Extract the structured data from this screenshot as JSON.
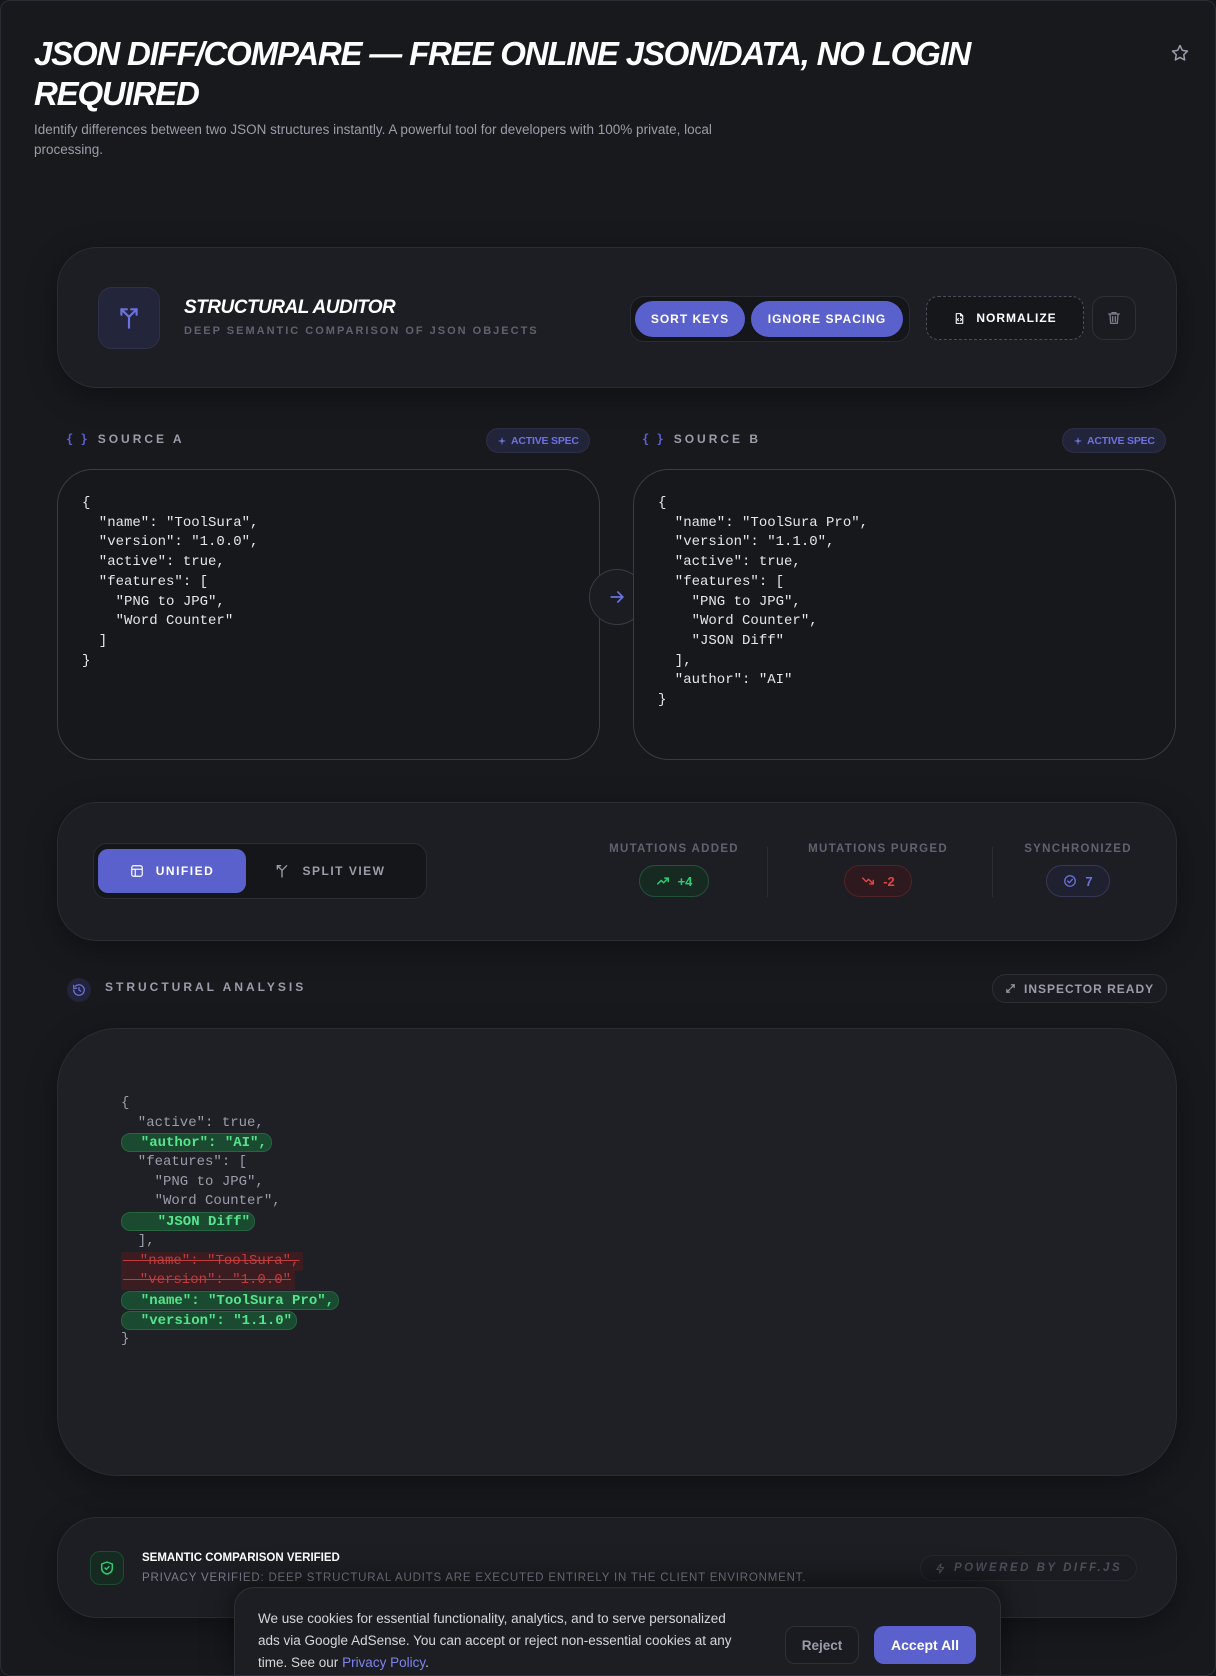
{
  "header": {
    "title": "JSON DIFF/COMPARE — FREE ONLINE JSON/DATA, NO LOGIN REQUIRED",
    "subtitle": "Identify differences between two JSON structures instantly. A powerful tool for developers with 100% private, local processing."
  },
  "auditor": {
    "title": "STRUCTURAL AUDITOR",
    "subtitle": "DEEP SEMANTIC COMPARISON OF JSON OBJECTS",
    "sort_keys": "SORT KEYS",
    "ignore_spacing": "IGNORE SPACING",
    "normalize": "NORMALIZE"
  },
  "source_a": {
    "label": "SOURCE A",
    "brace": "{ }",
    "badge": "ACTIVE SPEC",
    "content": "{\n  \"name\": \"ToolSura\",\n  \"version\": \"1.0.0\",\n  \"active\": true,\n  \"features\": [\n    \"PNG to JPG\",\n    \"Word Counter\"\n  ]\n}"
  },
  "source_b": {
    "label": "SOURCE B",
    "brace": "{ }",
    "badge": "ACTIVE SPEC",
    "content": "{\n  \"name\": \"ToolSura Pro\",\n  \"version\": \"1.1.0\",\n  \"active\": true,\n  \"features\": [\n    \"PNG to JPG\",\n    \"Word Counter\",\n    \"JSON Diff\"\n  ],\n  \"author\": \"AI\"\n}"
  },
  "view": {
    "unified": "UNIFIED",
    "split": "SPLIT VIEW"
  },
  "stats": {
    "added_label": "MUTATIONS ADDED",
    "added_value": "+4",
    "purged_label": "MUTATIONS PURGED",
    "purged_value": "-2",
    "sync_label": "SYNCHRONIZED",
    "sync_value": "7"
  },
  "analysis": {
    "label": "STRUCTURAL ANALYSIS",
    "badge": "INSPECTOR READY",
    "lines": [
      {
        "type": "same",
        "text": "{"
      },
      {
        "type": "same",
        "text": "  \"active\": true,"
      },
      {
        "type": "add",
        "text": "  \"author\": \"AI\","
      },
      {
        "type": "same",
        "text": "  \"features\": ["
      },
      {
        "type": "same",
        "text": "    \"PNG to JPG\","
      },
      {
        "type": "same",
        "text": "    \"Word Counter\","
      },
      {
        "type": "add",
        "text": "    \"JSON Diff\""
      },
      {
        "type": "same",
        "text": "  ],"
      },
      {
        "type": "del",
        "text": "  \"name\": \"ToolSura\","
      },
      {
        "type": "del",
        "text": "  \"version\": \"1.0.0\""
      },
      {
        "type": "add",
        "text": "  \"name\": \"ToolSura Pro\","
      },
      {
        "type": "add",
        "text": "  \"version\": \"1.1.0\""
      },
      {
        "type": "same",
        "text": "}"
      }
    ]
  },
  "verify": {
    "title": "SEMANTIC COMPARISON VERIFIED",
    "subtitle": "PRIVACY VERIFIED: DEEP STRUCTURAL AUDITS ARE EXECUTED ENTIRELY IN THE CLIENT ENVIRONMENT.",
    "powered": "POWERED BY DIFF.JS"
  },
  "cookie": {
    "text": "We use cookies for essential functionality, analytics, and to serve personalized ads via Google AdSense. You can accept or reject non-essential cookies at any time. See our",
    "link": "Privacy Policy",
    "end": ".",
    "reject": "Reject",
    "accept": "Accept All"
  },
  "colors": {
    "accent": "#5a61cc",
    "added": "#2fcd72",
    "removed": "#e04545",
    "background": "#18191d"
  },
  "icons": {
    "star": "star-icon",
    "auditor": "git-branch-icon",
    "normalize": "file-code-icon",
    "trash": "trash-icon",
    "arrow": "arrow-right-icon",
    "unified": "layout-icon",
    "split": "split-icon",
    "trend_up": "trending-up-icon",
    "trend_down": "trending-down-icon",
    "sync": "check-circle-icon",
    "history": "history-icon",
    "expand": "expand-icon",
    "shield": "shield-check-icon",
    "sparkle": "sparkle-icon"
  }
}
